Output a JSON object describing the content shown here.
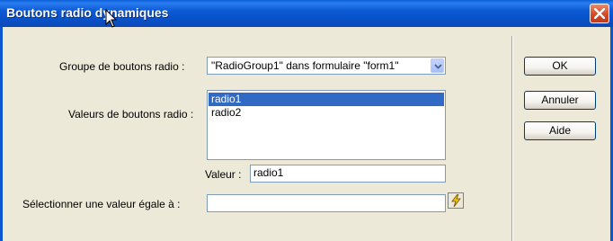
{
  "dialog": {
    "title": "Boutons radio dynamiques"
  },
  "form": {
    "group_label": "Groupe de boutons radio :",
    "group_value": "\"RadioGroup1\" dans formulaire \"form1\"",
    "values_label": "Valeurs de boutons radio :",
    "radio_values": [
      "radio1",
      "radio2"
    ],
    "selected_index": 0,
    "value_label": "Valeur :",
    "value_field": "radio1",
    "select_equal_label": "Sélectionner une valeur égale à :",
    "select_equal_field": ""
  },
  "buttons": {
    "ok": "OK",
    "cancel": "Annuler",
    "help": "Aide"
  },
  "icons": {
    "close": "close-icon",
    "dropdown": "chevron-down-icon",
    "dynamic_data": "lightning-bolt-icon",
    "cursor": "mouse-pointer-icon"
  },
  "colors": {
    "title_bar": "#0B57D0",
    "selection": "#316AC5",
    "close_button": "#D24A27",
    "dialog_background": "#ECE9D8"
  }
}
